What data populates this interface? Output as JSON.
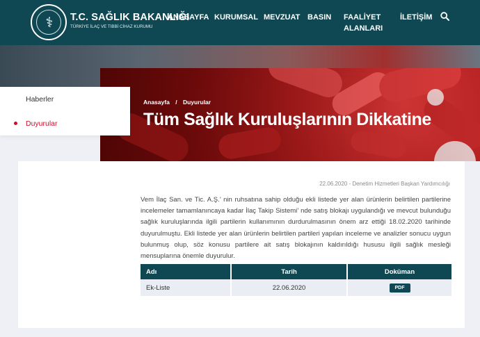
{
  "header": {
    "brand_title": "T.C. SAĞLIK BAKANLIĞI",
    "brand_subtitle": "TÜRKİYE İLAÇ VE TIBBİ CİHAZ KURUMU",
    "nav": [
      {
        "label": "ANASAYFA"
      },
      {
        "label": "KURUMSAL"
      },
      {
        "label": "MEVZUAT"
      },
      {
        "label": "BASIN"
      },
      {
        "label": "FAALİYET ALANLARI"
      },
      {
        "label": "İLETİŞİM"
      }
    ]
  },
  "breadcrumb": [
    "Anasayfa",
    "/",
    "Duyurular"
  ],
  "page_title": "Tüm Sağlık Kuruluşlarının Dikkatine",
  "sidebar": {
    "items": [
      {
        "label": "Haberler",
        "active": false
      },
      {
        "label": "Duyurular",
        "active": true
      }
    ]
  },
  "article": {
    "meta": "22.06.2020 - Denetim Hizmetleri Başkan Yardımcılığı",
    "body": "Vem İlaç San. ve Tic. A.Ş.’ nin ruhsatına sahip olduğu ekli listede yer alan ürünlerin belirtilen partilerine incelemeler tamamlanıncaya kadar İlaç Takip Sistemi’ nde satış blokajı uygulandığı ve mevcut bulunduğu sağlık kuruluşlarında ilgili partilerin  kullanımının durdurulmasının önem arz ettiği 18.02.2020 tarihinde duyurulmuştu. Ekli listede yer alan ürünlerin belirtilen partileri yapılan inceleme ve analizler sonucu uygun bulunmuş olup, söz konusu partilere ait satış blokajının kaldırıldığı hususu ilgili sağlık mesleği mensuplarına önemle duyurulur."
  },
  "table": {
    "headers": [
      "Adı",
      "Tarih",
      "Doküman"
    ],
    "rows": [
      {
        "name": "Ek-Liste",
        "date": "22.06.2020",
        "doc": "PDF"
      }
    ]
  },
  "colors": {
    "header_bg": "#0f4852",
    "accent_red": "#c8102e",
    "table_row_bg": "#eaeef4"
  },
  "icons": {
    "search": "search-icon",
    "logo": "ministry-logo-icon"
  }
}
